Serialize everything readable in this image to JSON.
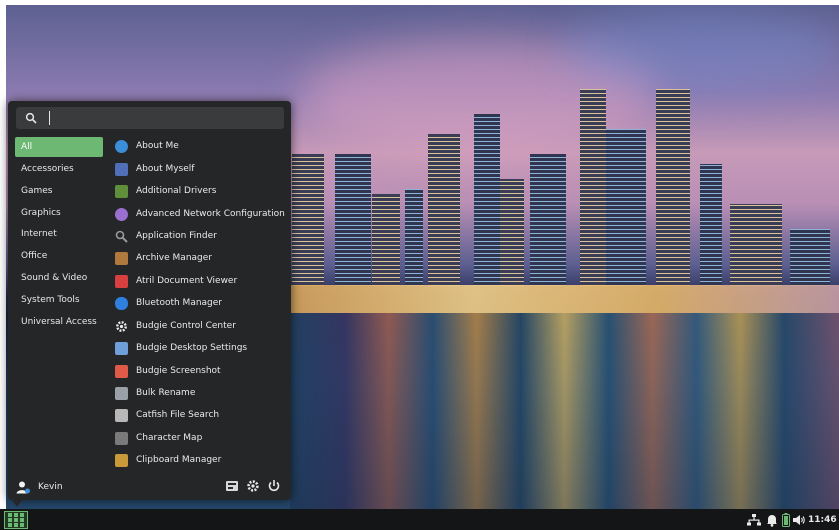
{
  "search": {
    "value": "",
    "placeholder": ""
  },
  "categories": [
    {
      "label": "All",
      "active": true
    },
    {
      "label": "Accessories",
      "active": false
    },
    {
      "label": "Games",
      "active": false
    },
    {
      "label": "Graphics",
      "active": false
    },
    {
      "label": "Internet",
      "active": false
    },
    {
      "label": "Office",
      "active": false
    },
    {
      "label": "Sound & Video",
      "active": false
    },
    {
      "label": "System Tools",
      "active": false
    },
    {
      "label": "Universal Access",
      "active": false
    }
  ],
  "apps": [
    {
      "label": "About Me",
      "icon": "person-icon",
      "color": "#3b8fd8"
    },
    {
      "label": "About Myself",
      "icon": "contact-card-icon",
      "color": "#4f6fb8"
    },
    {
      "label": "Additional Drivers",
      "icon": "circuit-board-icon",
      "color": "#5f8f3a"
    },
    {
      "label": "Advanced Network Configuration",
      "icon": "network-globe-icon",
      "color": "#9b6fd0"
    },
    {
      "label": "Application Finder",
      "icon": "magnifier-icon",
      "color": "#8a8a8a"
    },
    {
      "label": "Archive Manager",
      "icon": "archive-box-icon",
      "color": "#b07a3e"
    },
    {
      "label": "Atril Document Viewer",
      "icon": "document-viewer-icon",
      "color": "#d84040"
    },
    {
      "label": "Bluetooth Manager",
      "icon": "bluetooth-icon",
      "color": "#2f7fe0"
    },
    {
      "label": "Budgie Control Center",
      "icon": "gear-icon",
      "color": "#e8e8e8"
    },
    {
      "label": "Budgie Desktop Settings",
      "icon": "desktop-settings-icon",
      "color": "#6f9fd8"
    },
    {
      "label": "Budgie Screenshot",
      "icon": "camera-icon",
      "color": "#e05a4a"
    },
    {
      "label": "Bulk Rename",
      "icon": "folder-rename-icon",
      "color": "#9aa0a8"
    },
    {
      "label": "Catfish File Search",
      "icon": "file-search-icon",
      "color": "#b8b8b8"
    },
    {
      "label": "Character Map",
      "icon": "character-map-icon",
      "color": "#7a7a7a"
    },
    {
      "label": "Clipboard Manager",
      "icon": "clipboard-icon",
      "color": "#c89a3a"
    }
  ],
  "user": {
    "name": "Kevin"
  },
  "footer": {
    "settings_icon": "display-settings-icon",
    "gear_icon": "gear-icon",
    "power_icon": "power-icon"
  },
  "panel": {
    "launcher_icon": "app-grid-icon",
    "tray": [
      "network-icon",
      "notification-bell-icon",
      "battery-icon",
      "volume-icon"
    ],
    "clock": "11:46"
  },
  "colors": {
    "accent": "#6db872",
    "menu_bg": "#252627",
    "panel_bg": "#141516"
  }
}
